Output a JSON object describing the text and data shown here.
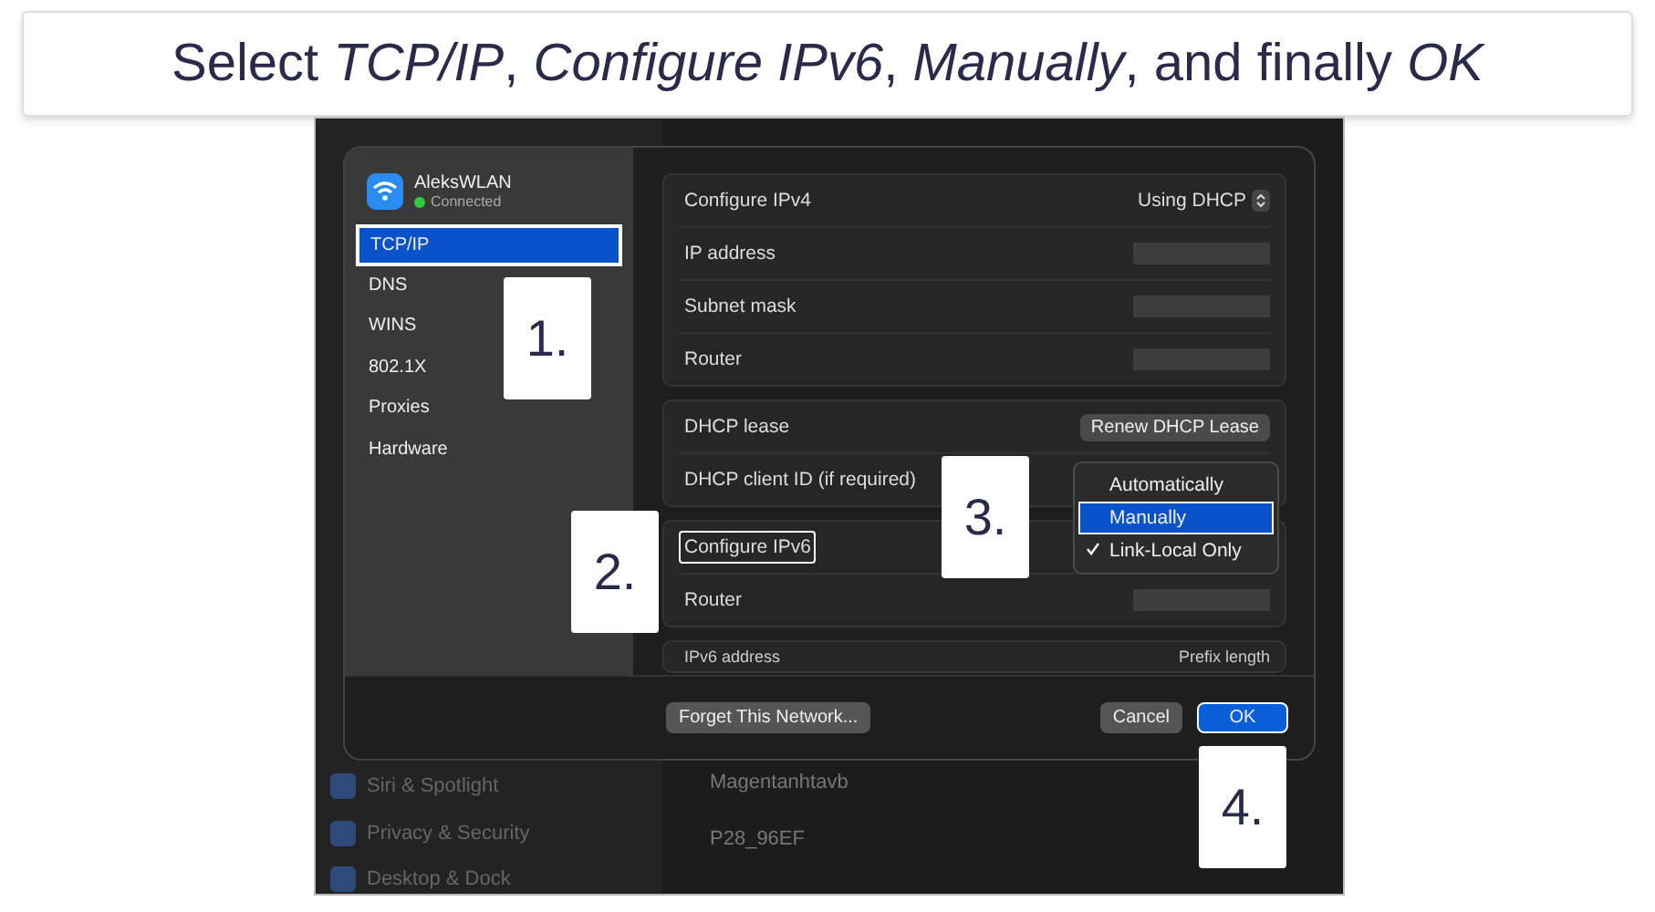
{
  "caption": "Select *TCP/IP*, *Configure IPv6*, *Manually*, and finally *OK*",
  "background": {
    "sidebar_items": [
      "Siri & Spotlight",
      "Privacy & Security",
      "Desktop & Dock"
    ],
    "networks": [
      "Magentanhtavb",
      "P28_96EF"
    ]
  },
  "dialog": {
    "network": {
      "name": "AleksWLAN",
      "status": "Connected"
    },
    "tabs": [
      {
        "label": "TCP/IP",
        "selected": true
      },
      {
        "label": "DNS",
        "selected": false
      },
      {
        "label": "WINS",
        "selected": false
      },
      {
        "label": "802.1X",
        "selected": false
      },
      {
        "label": "Proxies",
        "selected": false
      },
      {
        "label": "Hardware",
        "selected": false
      }
    ],
    "groups": [
      {
        "rows": [
          {
            "kind": "select",
            "label": "Configure IPv4",
            "value": "Using DHCP",
            "highlighted": false
          },
          {
            "kind": "redacted",
            "label": "IP address",
            "highlighted": false
          },
          {
            "kind": "redacted",
            "label": "Subnet mask",
            "highlighted": false
          },
          {
            "kind": "redacted",
            "label": "Router",
            "highlighted": false
          }
        ]
      },
      {
        "rows": [
          {
            "kind": "button",
            "label": "DHCP lease",
            "value": "Renew DHCP Lease",
            "highlighted": false
          },
          {
            "kind": "plain",
            "label": "DHCP client ID (if required)",
            "highlighted": false
          }
        ]
      },
      {
        "rows": [
          {
            "kind": "plain",
            "label": "Configure IPv6",
            "highlighted": true
          },
          {
            "kind": "redacted",
            "label": "Router",
            "highlighted": false
          }
        ]
      },
      {
        "rows": [
          {
            "kind": "header",
            "label": "IPv6 address",
            "value": "Prefix length",
            "highlighted": false
          }
        ]
      }
    ],
    "menu": {
      "options": [
        {
          "label": "Automatically",
          "selected": false,
          "checked": false
        },
        {
          "label": "Manually",
          "selected": true,
          "checked": false
        },
        {
          "label": "Link-Local Only",
          "selected": false,
          "checked": true
        }
      ]
    },
    "buttons": [
      {
        "label": "Forget This Network...",
        "kind": "secondary",
        "highlighted": false
      },
      {
        "label": "Cancel",
        "kind": "secondary",
        "highlighted": false
      },
      {
        "label": "OK",
        "kind": "primary",
        "highlighted": true
      }
    ]
  },
  "callouts": [
    {
      "label": "1."
    },
    {
      "label": "2."
    },
    {
      "label": "3."
    },
    {
      "label": "4."
    }
  ]
}
